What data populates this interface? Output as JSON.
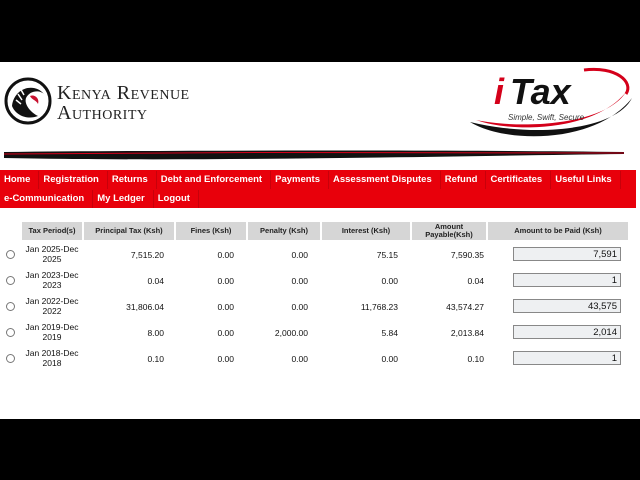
{
  "header": {
    "org_line1": "Kenya Revenue",
    "org_line2": "Authority",
    "brand_i": "i",
    "brand_tax": "Tax",
    "brand_tagline": "Simple, Swift, Secure"
  },
  "nav": {
    "row1": [
      "Home",
      "Registration",
      "Returns",
      "Debt and Enforcement",
      "Payments",
      "Assessment Disputes",
      "Refund",
      "Certificates",
      "Useful Links"
    ],
    "row2": [
      "e-Communication",
      "My Ledger",
      "Logout"
    ]
  },
  "table": {
    "headers": {
      "period": "Tax Period(s)",
      "principal": "Principal Tax (Ksh)",
      "fines": "Fines (Ksh)",
      "penalty": "Penalty (Ksh)",
      "interest": "Interest (Ksh)",
      "payable": "Amount Payable(Ksh)",
      "to_pay": "Amount to be Paid (Ksh)"
    },
    "rows": [
      {
        "period": "Jan 2025-Dec 2025",
        "principal": "7,515.20",
        "fines": "0.00",
        "penalty": "0.00",
        "interest": "75.15",
        "payable": "7,590.35",
        "to_pay": "7,591"
      },
      {
        "period": "Jan 2023-Dec 2023",
        "principal": "0.04",
        "fines": "0.00",
        "penalty": "0.00",
        "interest": "0.00",
        "payable": "0.04",
        "to_pay": "1"
      },
      {
        "period": "Jan 2022-Dec 2022",
        "principal": "31,806.04",
        "fines": "0.00",
        "penalty": "0.00",
        "interest": "11,768.23",
        "payable": "43,574.27",
        "to_pay": "43,575"
      },
      {
        "period": "Jan 2019-Dec 2019",
        "principal": "8.00",
        "fines": "0.00",
        "penalty": "2,000.00",
        "interest": "5.84",
        "payable": "2,013.84",
        "to_pay": "2,014"
      },
      {
        "period": "Jan 2018-Dec 2018",
        "principal": "0.10",
        "fines": "0.00",
        "penalty": "0.00",
        "interest": "0.00",
        "payable": "0.10",
        "to_pay": "1"
      }
    ]
  },
  "colors": {
    "nav_red": "#e8000b",
    "header_gray": "#d6d6d6",
    "brand_red": "#d4001a"
  }
}
